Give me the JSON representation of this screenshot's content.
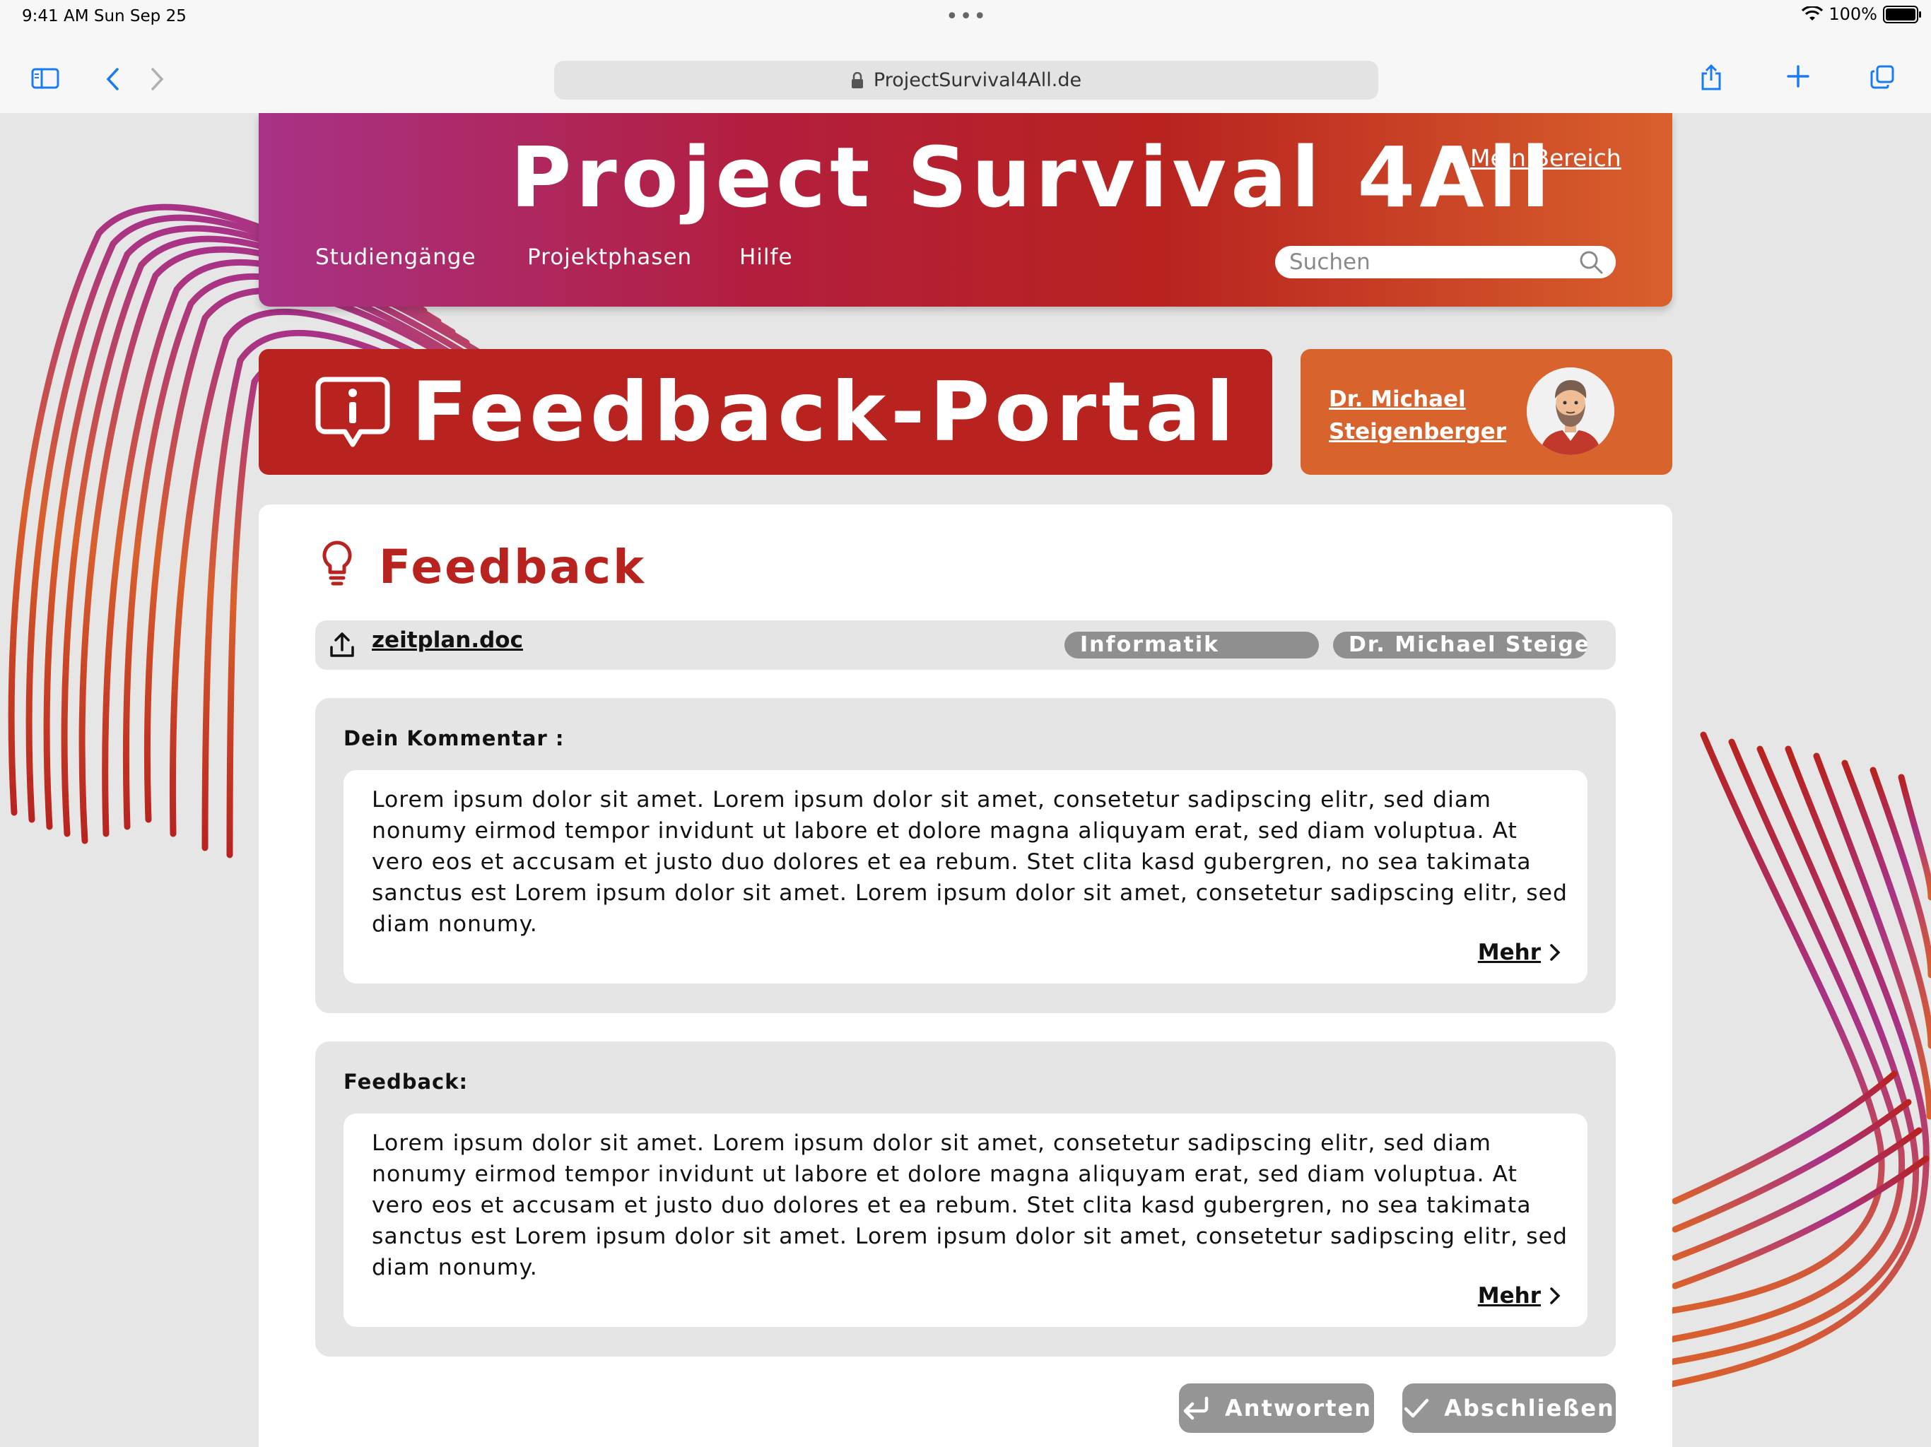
{
  "status_bar": {
    "time_date": "9:41 AM   Sun Sep 25",
    "battery": "100%"
  },
  "browser": {
    "url": "ProjectSurvival4All.de"
  },
  "header": {
    "title": "Project Survival 4All",
    "account_label": "Mein Bereich",
    "nav": [
      "Studiengänge",
      "Projektphasen",
      "Hilfe"
    ],
    "search_placeholder": "Suchen"
  },
  "portal": {
    "title": "Feedback-Portal",
    "profile_name": "Dr. Michael Steigenberger"
  },
  "feedback": {
    "title": "Feedback",
    "file_name": "zeitplan.doc",
    "tags": [
      "Informatik",
      "Dr. Michael Steige..."
    ],
    "comment_label": "Dein Kommentar :",
    "comment_text": "Lorem ipsum dolor sit amet. Lorem ipsum dolor sit amet, consetetur sadipscing elitr, sed diam nonumy eirmod tempor invidunt ut labore et dolore magna aliquyam erat, sed diam voluptua. At vero eos et accusam et justo duo dolores et ea rebum. Stet clita kasd gubergren, no sea takimata sanctus est Lorem ipsum dolor sit amet. Lorem ipsum dolor sit amet, consetetur sadipscing elitr, sed diam nonumy.",
    "feedback_label": "Feedback:",
    "feedback_text": "Lorem ipsum dolor sit amet. Lorem ipsum dolor sit amet, consetetur sadipscing elitr, sed diam nonumy eirmod tempor invidunt ut labore et dolore magna aliquyam erat, sed diam voluptua. At vero eos et accusam et justo duo dolores et ea rebum. Stet clita kasd gubergren, no sea takimata sanctus est Lorem ipsum dolor sit amet. Lorem ipsum dolor sit amet, consetetur sadipscing elitr, sed diam nonumy.",
    "more_label": "Mehr",
    "reply_label": "Antworten",
    "close_label": "Abschließen"
  },
  "colors": {
    "brand_red": "#b8231f",
    "brand_orange": "#d9632c",
    "brand_magenta": "#a83286",
    "button_grey": "#959595"
  }
}
